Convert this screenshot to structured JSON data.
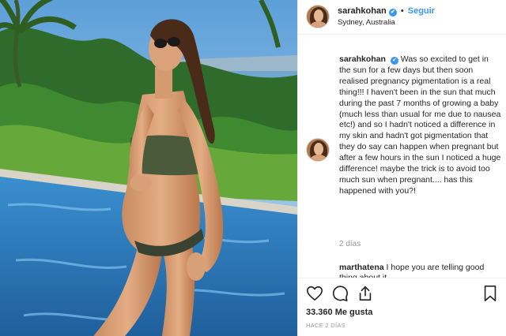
{
  "header": {
    "username": "sarahkohan",
    "verified_icon": "✔",
    "separator": "•",
    "follow_label": "Seguir",
    "location": "Sydney, Australia"
  },
  "caption": {
    "username": "sarahkohan",
    "text": "Was so excited to get in the sun for a few days but then soon realised pregnancy pigmentation is a real thing!!! I haven't been in the sun that much during the past 7 months of growing a baby (much less than usual for me due to nausea etc!) and so I hadn't noticed a difference in my skin and hadn't got pigmentation that they do say can happen when pregnant but after a few hours in the sun I noticed a huge difference! maybe the trick is to avoid too much sun when pregnant.... has this happened with you?!",
    "time": "2 días"
  },
  "comment": {
    "username": "marthatena",
    "text": "I hope you are telling good thing about it"
  },
  "actions": {
    "likes": "33.360 Me gusta",
    "posted_ago": "HACE 2 DÍAS"
  },
  "colors": {
    "link_blue": "#3897f0",
    "muted": "#999999",
    "text": "#262626"
  },
  "icons": [
    "heart-icon",
    "comment-icon",
    "share-icon",
    "bookmark-icon",
    "verified-icon",
    "comment-like-icon"
  ]
}
